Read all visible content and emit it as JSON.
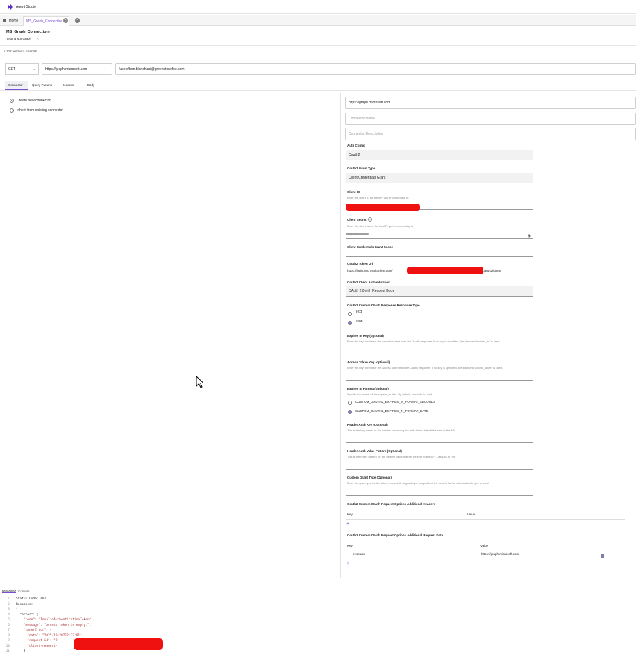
{
  "app": {
    "title": "Agent Studio"
  },
  "tabs": {
    "home": "Home",
    "active": "MS_Graph_Connection",
    "close": "×"
  },
  "header": {
    "name": "MS_Graph_Connection",
    "description": "Testing MS Graph",
    "section_label": "HTTP ACTION EDITOR"
  },
  "request": {
    "method": "GET",
    "base_url": "https://graph.microsoft.com",
    "path": "/users/ben.blanchard@greenstonefoe.com"
  },
  "subtabs": [
    "Connector",
    "Query Params",
    "Headers",
    "Body"
  ],
  "connector_choice": {
    "create": "Create new connector",
    "inherit": "Inherit from existing connector"
  },
  "form": {
    "base_url_value": "https://graph.microsoft.com",
    "connector_name_placeholder": "Connector Name",
    "connector_description_placeholder": "Connector Description",
    "auth_config_label": "Auth Config",
    "auth_config_value": "Oauth2",
    "grant_type_label": "Oauth2 Grant Type",
    "grant_type_value": "Client Credentials Grant",
    "client_id_label": "Client ID",
    "client_id_help": "Enter the client ID for the API you're connecting to.",
    "client_secret_label": "Client Secret",
    "client_secret_help": "Enter the client secret for the API you're connecting to.",
    "client_secret_value": "••••••••••••••••••••••••••••••••••••",
    "scope_label": "Client Credentials Grant Scope",
    "token_url_label": "Oauth2 Token Url",
    "token_url_prefix": "https://login.microsoftonline.com/",
    "token_url_suffix": "/oauth2/token",
    "client_auth_label": "Oauth2 Client Authentication",
    "client_auth_value": "OAuth 2.0 with Request Body",
    "response_type_label": "Oauth2 Custom Oauth Response Response Type",
    "response_type_text": "Text",
    "response_type_json": "Json",
    "expires_key_label": "Expires In Key (optional)",
    "expires_key_help": "Enter the key to retrieve the expiration time from the OAuth response. If no key is specified, the standard 'expires_in' is used.",
    "access_token_key_label": "Access Token Key (optional)",
    "access_token_key_help": "Enter the key to retrieve the access token from the OAuth response. If no key is specified, the standard 'access_token' is used.",
    "expires_format_label": "Expires In Format (optional)",
    "expires_format_help": "Specify the format of the expires_in field. By default, seconds is used.",
    "expires_format_seconds": "CUSTOM_OAUTH2_EXPIRES_IN_FORMAT_SECONDS",
    "expires_format_date": "CUSTOM_OAUTH2_EXPIRES_IN_FORMAT_DATE",
    "header_auth_key_label": "Header Auth Key (Optional)",
    "header_auth_key_help": "This is the key name for the header containing the auth token that will be sent to the API.",
    "header_auth_value_label": "Header Auth Value Pattern (Optional)",
    "header_auth_value_help": "This is the regex pattern for the header value that will be sent to the API. Defaults to \"%s\"",
    "custom_grant_label": "Custom Grant Type (Optional)",
    "custom_grant_help": "Enter the grant type for the token request. If no grant type is specified, the default for the selected auth type is used.",
    "additional_headers_label": "Oauth2 Custom Oauth Request Options Additional Headers",
    "key_col": "Key",
    "value_col": "Value",
    "additional_data_label": "Oauth2 Custom Oauth Request Options Additional Request Data",
    "data_key": "resource",
    "data_value": "https://graph.microsoft.com",
    "add": "+"
  },
  "bottom": {
    "tabs": [
      "Response",
      "Console"
    ],
    "lines": [
      {
        "n": "1",
        "t": "Status Code: 401"
      },
      {
        "n": "2",
        "t": "Response:"
      },
      {
        "n": "3",
        "t": "{"
      },
      {
        "n": "4",
        "t": "  \"error\": {"
      },
      {
        "n": "5",
        "t": "    \"code\": \"InvalidAuthenticationToken\","
      },
      {
        "n": "6",
        "t": "    \"message\": \"Access token is empty.\","
      },
      {
        "n": "7",
        "t": "    \"innerError\": {"
      },
      {
        "n": "8",
        "t": "      \"date\": \"2025-10-20T12:22:01\","
      },
      {
        "n": "9",
        "t": "      \"request-id\": \"9"
      },
      {
        "n": "10",
        "t": "      \"client-request-"
      },
      {
        "n": "11",
        "t": "    }"
      }
    ]
  },
  "colors": {
    "accent": "#7a4fd0",
    "redaction": "#ef1010"
  }
}
